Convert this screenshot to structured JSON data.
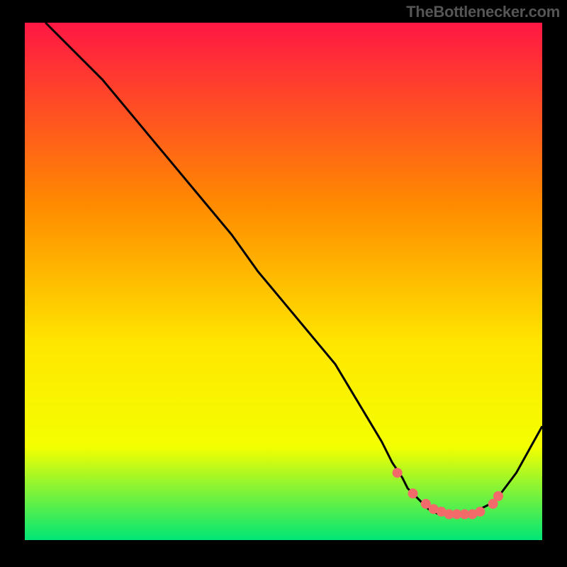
{
  "watermark": "TheBottlenecker.com",
  "chart_data": {
    "type": "line",
    "title": "",
    "xlabel": "",
    "ylabel": "",
    "xlim": [
      0,
      100
    ],
    "ylim": [
      0,
      100
    ],
    "background_gradient": {
      "top": "#ff1744",
      "mid_upper": "#ff8a00",
      "mid": "#ffe600",
      "mid_lower": "#f4ff00",
      "bottom": "#00e676"
    },
    "curve": {
      "name": "bottleneck-curve",
      "x": [
        4,
        10,
        15,
        20,
        25,
        30,
        35,
        40,
        45,
        50,
        55,
        60,
        63,
        66,
        69,
        71,
        73,
        74,
        76,
        78,
        80,
        82,
        84,
        86,
        88,
        90,
        92,
        95,
        100
      ],
      "y": [
        100,
        94,
        89,
        83,
        77,
        71,
        65,
        59,
        52,
        46,
        40,
        34,
        29,
        24,
        19,
        15,
        12,
        10,
        8,
        6,
        5,
        5,
        5,
        5,
        6,
        7,
        9,
        13,
        22
      ]
    },
    "highlight_points": {
      "name": "marker-dots",
      "color": "#f26a6a",
      "x": [
        72,
        75,
        77.5,
        79,
        80.5,
        82,
        83.5,
        85,
        86.5,
        88,
        90.5,
        91.5
      ],
      "y": [
        13,
        9,
        7,
        6,
        5.5,
        5,
        5,
        5,
        5,
        5.5,
        7,
        8.5
      ]
    }
  }
}
